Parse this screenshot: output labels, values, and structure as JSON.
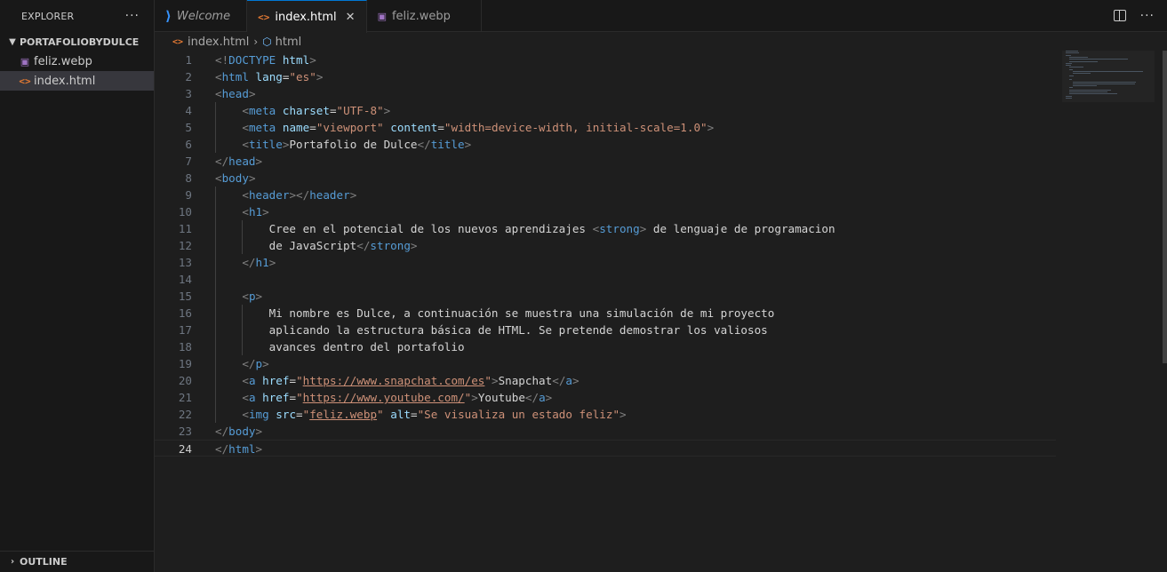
{
  "sidebar": {
    "title": "EXPLORER",
    "more": "···",
    "folder": "PORTAFOLIOBYDULCE",
    "files": [
      {
        "name": "feliz.webp",
        "icon": "image-file-icon"
      },
      {
        "name": "index.html",
        "icon": "html-file-icon"
      }
    ],
    "outline": "OUTLINE"
  },
  "tabs": [
    {
      "label": "Welcome",
      "icon": "vscode-icon"
    },
    {
      "label": "index.html",
      "icon": "html-file-icon",
      "close": "✕"
    },
    {
      "label": "feliz.webp",
      "icon": "image-file-icon"
    }
  ],
  "tab_actions": {
    "more": "···"
  },
  "breadcrumb": {
    "file": "index.html",
    "symbol": "html"
  },
  "editor": {
    "current_line": 24,
    "lines": [
      {
        "n": "1",
        "tokens": [
          [
            "br",
            "<!"
          ],
          [
            "tag",
            "DOCTYPE"
          ],
          [
            "txt",
            " "
          ],
          [
            "attr",
            "html"
          ],
          [
            "br",
            ">"
          ]
        ]
      },
      {
        "n": "2",
        "tokens": [
          [
            "br",
            "<"
          ],
          [
            "tag",
            "html"
          ],
          [
            "txt",
            " "
          ],
          [
            "attr",
            "lang"
          ],
          [
            "txt",
            "="
          ],
          [
            "str",
            "\"es\""
          ],
          [
            "br",
            ">"
          ]
        ]
      },
      {
        "n": "3",
        "tokens": [
          [
            "br",
            "<"
          ],
          [
            "tag",
            "head"
          ],
          [
            "br",
            ">"
          ]
        ]
      },
      {
        "n": "4",
        "tokens": [
          [
            "txt",
            "    "
          ],
          [
            "br",
            "<"
          ],
          [
            "tag",
            "meta"
          ],
          [
            "txt",
            " "
          ],
          [
            "attr",
            "charset"
          ],
          [
            "txt",
            "="
          ],
          [
            "str",
            "\"UTF-8\""
          ],
          [
            "br",
            ">"
          ]
        ]
      },
      {
        "n": "5",
        "tokens": [
          [
            "txt",
            "    "
          ],
          [
            "br",
            "<"
          ],
          [
            "tag",
            "meta"
          ],
          [
            "txt",
            " "
          ],
          [
            "attr",
            "name"
          ],
          [
            "txt",
            "="
          ],
          [
            "str",
            "\"viewport\""
          ],
          [
            "txt",
            " "
          ],
          [
            "attr",
            "content"
          ],
          [
            "txt",
            "="
          ],
          [
            "str",
            "\"width=device-width, initial-scale=1.0\""
          ],
          [
            "br",
            ">"
          ]
        ]
      },
      {
        "n": "6",
        "tokens": [
          [
            "txt",
            "    "
          ],
          [
            "br",
            "<"
          ],
          [
            "tag",
            "title"
          ],
          [
            "br",
            ">"
          ],
          [
            "txt",
            "Portafolio de Dulce"
          ],
          [
            "br",
            "</"
          ],
          [
            "tag",
            "title"
          ],
          [
            "br",
            ">"
          ]
        ]
      },
      {
        "n": "7",
        "tokens": [
          [
            "br",
            "</"
          ],
          [
            "tag",
            "head"
          ],
          [
            "br",
            ">"
          ]
        ]
      },
      {
        "n": "8",
        "tokens": [
          [
            "br",
            "<"
          ],
          [
            "tag",
            "body"
          ],
          [
            "br",
            ">"
          ]
        ]
      },
      {
        "n": "9",
        "tokens": [
          [
            "txt",
            "    "
          ],
          [
            "br",
            "<"
          ],
          [
            "tag",
            "header"
          ],
          [
            "br",
            "></"
          ],
          [
            "tag",
            "header"
          ],
          [
            "br",
            ">"
          ]
        ]
      },
      {
        "n": "10",
        "tokens": [
          [
            "txt",
            "    "
          ],
          [
            "br",
            "<"
          ],
          [
            "tag",
            "h1"
          ],
          [
            "br",
            ">"
          ]
        ]
      },
      {
        "n": "11",
        "tokens": [
          [
            "txt",
            "        Cree en el potencial de los nuevos aprendizajes "
          ],
          [
            "br",
            "<"
          ],
          [
            "tag",
            "strong"
          ],
          [
            "br",
            ">"
          ],
          [
            "txt",
            " de lenguaje de programacion"
          ]
        ]
      },
      {
        "n": "12",
        "tokens": [
          [
            "txt",
            "        de JavaScript"
          ],
          [
            "br",
            "</"
          ],
          [
            "tag",
            "strong"
          ],
          [
            "br",
            ">"
          ]
        ]
      },
      {
        "n": "13",
        "tokens": [
          [
            "txt",
            "    "
          ],
          [
            "br",
            "</"
          ],
          [
            "tag",
            "h1"
          ],
          [
            "br",
            ">"
          ]
        ]
      },
      {
        "n": "14",
        "tokens": []
      },
      {
        "n": "15",
        "tokens": [
          [
            "txt",
            "    "
          ],
          [
            "br",
            "<"
          ],
          [
            "tag",
            "p"
          ],
          [
            "br",
            ">"
          ]
        ]
      },
      {
        "n": "16",
        "tokens": [
          [
            "txt",
            "        Mi nombre es Dulce, a continuación se muestra una simulación de mi proyecto"
          ]
        ]
      },
      {
        "n": "17",
        "tokens": [
          [
            "txt",
            "        aplicando la estructura básica de HTML. Se pretende demostrar los valiosos"
          ]
        ]
      },
      {
        "n": "18",
        "tokens": [
          [
            "txt",
            "        avances dentro del portafolio"
          ]
        ]
      },
      {
        "n": "19",
        "tokens": [
          [
            "txt",
            "    "
          ],
          [
            "br",
            "</"
          ],
          [
            "tag",
            "p"
          ],
          [
            "br",
            ">"
          ]
        ]
      },
      {
        "n": "20",
        "tokens": [
          [
            "txt",
            "    "
          ],
          [
            "br",
            "<"
          ],
          [
            "tag",
            "a"
          ],
          [
            "txt",
            " "
          ],
          [
            "attr",
            "href"
          ],
          [
            "txt",
            "="
          ],
          [
            "str",
            "\""
          ],
          [
            "link",
            "https://www.snapchat.com/es"
          ],
          [
            "str",
            "\""
          ],
          [
            "br",
            ">"
          ],
          [
            "txt",
            "Snapchat"
          ],
          [
            "br",
            "</"
          ],
          [
            "tag",
            "a"
          ],
          [
            "br",
            ">"
          ]
        ]
      },
      {
        "n": "21",
        "tokens": [
          [
            "txt",
            "    "
          ],
          [
            "br",
            "<"
          ],
          [
            "tag",
            "a"
          ],
          [
            "txt",
            " "
          ],
          [
            "attr",
            "href"
          ],
          [
            "txt",
            "="
          ],
          [
            "str",
            "\""
          ],
          [
            "link",
            "https://www.youtube.com/"
          ],
          [
            "str",
            "\""
          ],
          [
            "br",
            ">"
          ],
          [
            "txt",
            "Youtube"
          ],
          [
            "br",
            "</"
          ],
          [
            "tag",
            "a"
          ],
          [
            "br",
            ">"
          ]
        ]
      },
      {
        "n": "22",
        "tokens": [
          [
            "txt",
            "    "
          ],
          [
            "br",
            "<"
          ],
          [
            "tag",
            "img"
          ],
          [
            "txt",
            " "
          ],
          [
            "attr",
            "src"
          ],
          [
            "txt",
            "="
          ],
          [
            "str",
            "\""
          ],
          [
            "link",
            "feliz.webp"
          ],
          [
            "str",
            "\""
          ],
          [
            "txt",
            " "
          ],
          [
            "attr",
            "alt"
          ],
          [
            "txt",
            "="
          ],
          [
            "str",
            "\"Se visualiza un estado feliz\""
          ],
          [
            "br",
            ">"
          ]
        ]
      },
      {
        "n": "23",
        "tokens": [
          [
            "br",
            "</"
          ],
          [
            "tag",
            "body"
          ],
          [
            "br",
            ">"
          ]
        ]
      },
      {
        "n": "24",
        "tokens": [
          [
            "br",
            "</"
          ],
          [
            "tag",
            "html"
          ],
          [
            "br",
            ">"
          ]
        ]
      }
    ]
  },
  "colors": {
    "background": "#1e1e1e",
    "sidebar": "#181818",
    "tag": "#569cd6",
    "attribute": "#9cdcfe",
    "string": "#ce9178",
    "text": "#d4d4d4",
    "accent": "#0078d4"
  }
}
